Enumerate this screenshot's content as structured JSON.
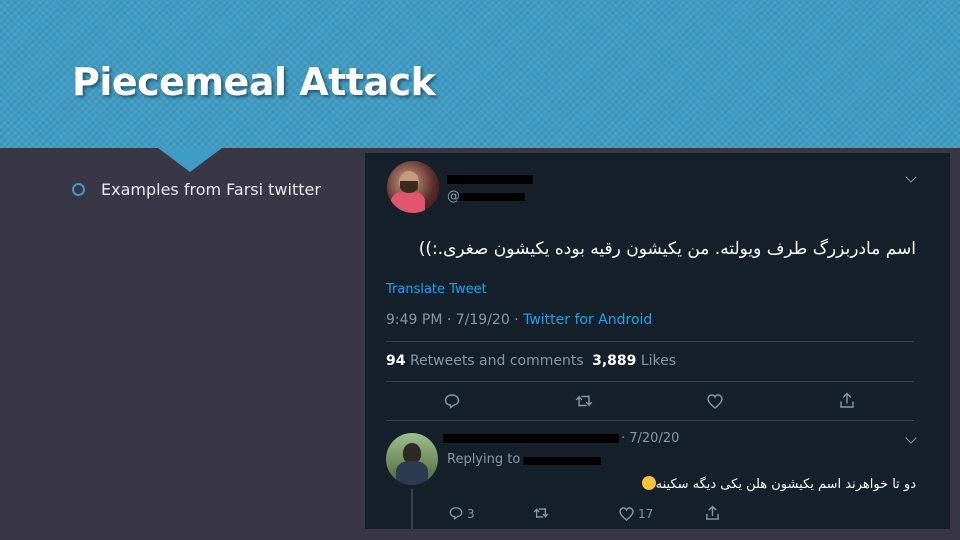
{
  "slide": {
    "title": "Piecemeal Attack",
    "bullets": [
      "Examples from Farsi twitter"
    ],
    "accent": "#3f9cc4"
  },
  "tweet": {
    "handle_prefix": "@",
    "text": "اسم مادربزرگ طرف ویولته. من یکیشون رقیه بوده یکیشون صغری.:))",
    "translate": "Translate Tweet",
    "time": "9:49 PM · 7/19/20 · ",
    "client": "Twitter for Android",
    "retweets_count": "94",
    "retweets_label": "Retweets and comments",
    "likes_count": "3,889",
    "likes_label": "Likes",
    "actions": [
      "reply-icon",
      "retweet-icon",
      "like-icon",
      "share-icon"
    ]
  },
  "reply": {
    "date": "· 7/20/20",
    "replying_to": "Replying to",
    "text": "دو تا خواهرند اسم یکیشون هلن یکی دیگه سکینه",
    "reply_count": "3",
    "like_count": "17"
  },
  "colors": {
    "tweet_bg": "#15202b",
    "link": "#1da1f2",
    "muted": "#8899a6"
  }
}
